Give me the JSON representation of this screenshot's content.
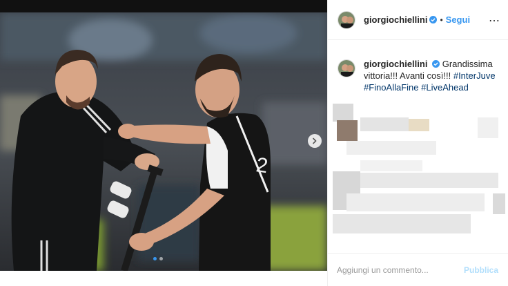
{
  "post": {
    "username": "giorgiochiellini",
    "separator": "•",
    "follow_label": "Segui",
    "more_icon": "⋯",
    "caption_text": "Grandissima vittoria!!! Avanti così!!!",
    "hashtags": [
      "#InterJuve",
      "#FinoAllaFine",
      "#LiveAhead"
    ],
    "carousel": {
      "count": 2,
      "active": 0
    }
  },
  "comment": {
    "placeholder": "Aggiungi un commento...",
    "publish_label": "Pubblica"
  },
  "colors": {
    "accent": "#3897f0",
    "verified": "#3897f0",
    "hashtag": "#003569",
    "publish_disabled": "#b2dffc"
  },
  "icons": {
    "verified": "verified-badge-icon",
    "next": "chevron-right-icon",
    "more": "more-options-icon"
  }
}
